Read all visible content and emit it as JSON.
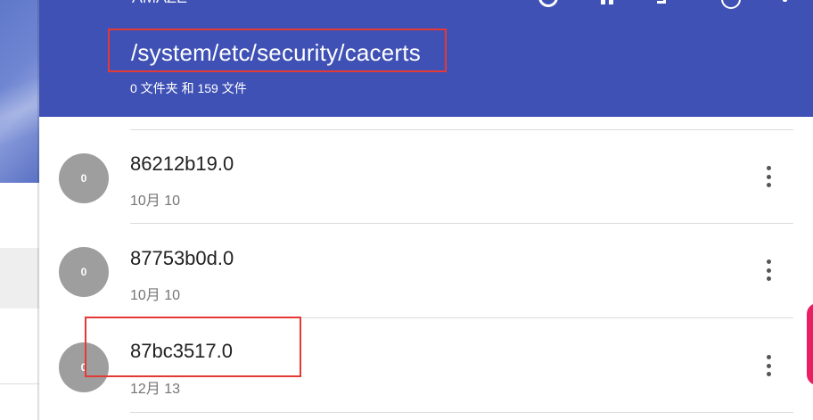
{
  "left_background": {
    "accent": "#5f78c9"
  },
  "header": {
    "title": "AMAZE",
    "path": "/system/etc/security/cacerts",
    "summary": "0 文件夹 和 159 文件",
    "background": "#3f51b5",
    "toolbar_icons": [
      "search-icon",
      "view-toggle-icon",
      "sort-icon",
      "history-icon",
      "more-vert-icon"
    ]
  },
  "files": [
    {
      "avatar_label": "0",
      "name": "86212b19.0",
      "date": "10月 10"
    },
    {
      "avatar_label": "0",
      "name": "87753b0d.0",
      "date": "10月 10"
    },
    {
      "avatar_label": "0",
      "name": "87bc3517.0",
      "date": "12月 13"
    }
  ],
  "colors": {
    "highlight": "#e53935",
    "avatar": "#9e9e9e",
    "fab": "#e91e63"
  }
}
